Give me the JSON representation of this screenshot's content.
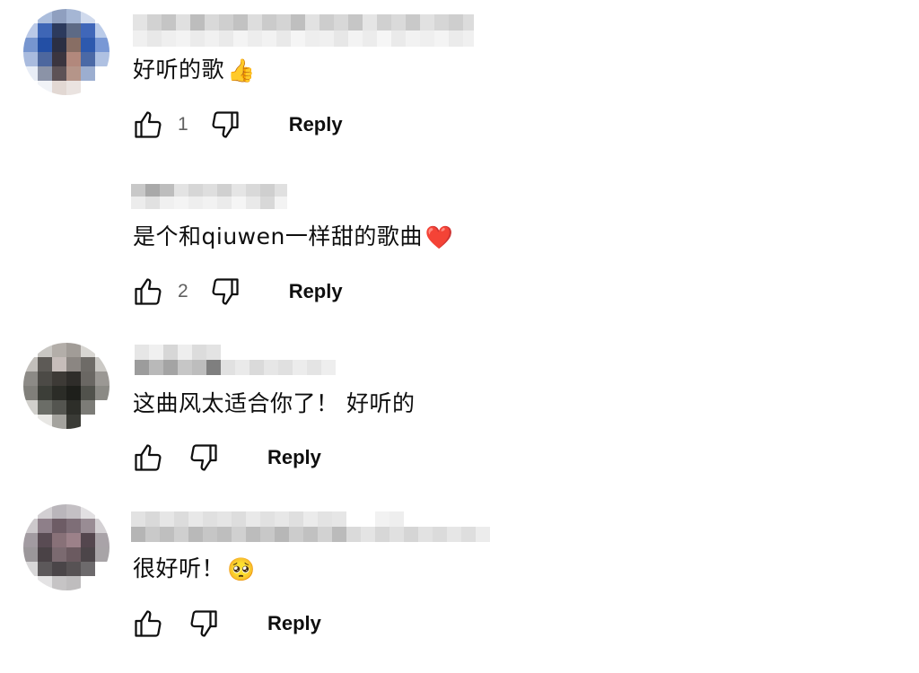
{
  "comments": [
    {
      "text": "好听的歌",
      "emoji": "👍",
      "emoji_name": "thumbs-up-emoji",
      "likes": "1",
      "reply_label": "Reply"
    },
    {
      "text": "是个和qiuwen一样甜的歌曲",
      "emoji": "❤️",
      "emoji_name": "red-heart-emoji",
      "likes": "2",
      "reply_label": "Reply"
    },
    {
      "text": "这曲风太适合你了！ 好听的",
      "emoji": "",
      "emoji_name": "",
      "likes": "",
      "reply_label": "Reply"
    },
    {
      "text": "很好听！",
      "emoji": "🥺",
      "emoji_name": "pleading-face-emoji",
      "likes": "",
      "reply_label": "Reply"
    }
  ],
  "colors": {
    "text": "#0f0f0f",
    "secondary": "#606060",
    "background": "#ffffff"
  }
}
